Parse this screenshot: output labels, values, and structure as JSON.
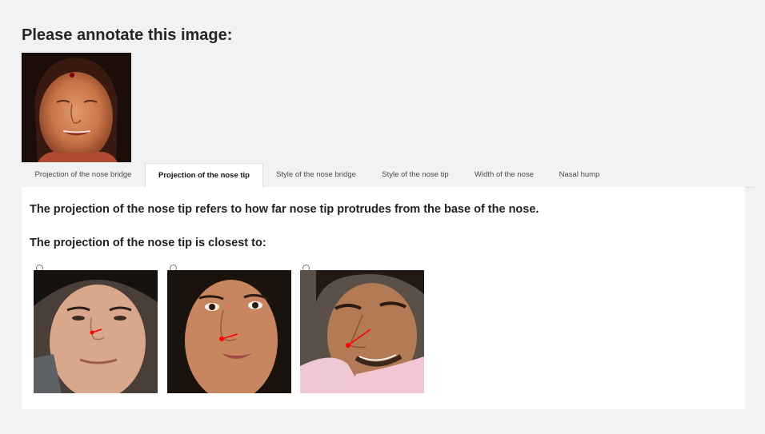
{
  "heading": "Please annotate this image:",
  "tabs": [
    {
      "label": "Projection of the nose bridge",
      "active": false
    },
    {
      "label": "Projection of the nose tip",
      "active": true
    },
    {
      "label": "Style of the nose bridge",
      "active": false
    },
    {
      "label": "Style of the nose tip",
      "active": false
    },
    {
      "label": "Width of the nose",
      "active": false
    },
    {
      "label": "Nasal hump",
      "active": false
    }
  ],
  "panel": {
    "description": "The projection of the nose tip refers to how far nose tip protrudes from the base of the nose.",
    "question": "The projection of the nose tip is closest to:"
  },
  "options": [
    {
      "selected": false
    },
    {
      "selected": false
    },
    {
      "selected": false
    }
  ],
  "colors": {
    "page_background": "#f1f2f3",
    "panel_background": "#ffffff",
    "annotation_marker": "#ff0000"
  }
}
